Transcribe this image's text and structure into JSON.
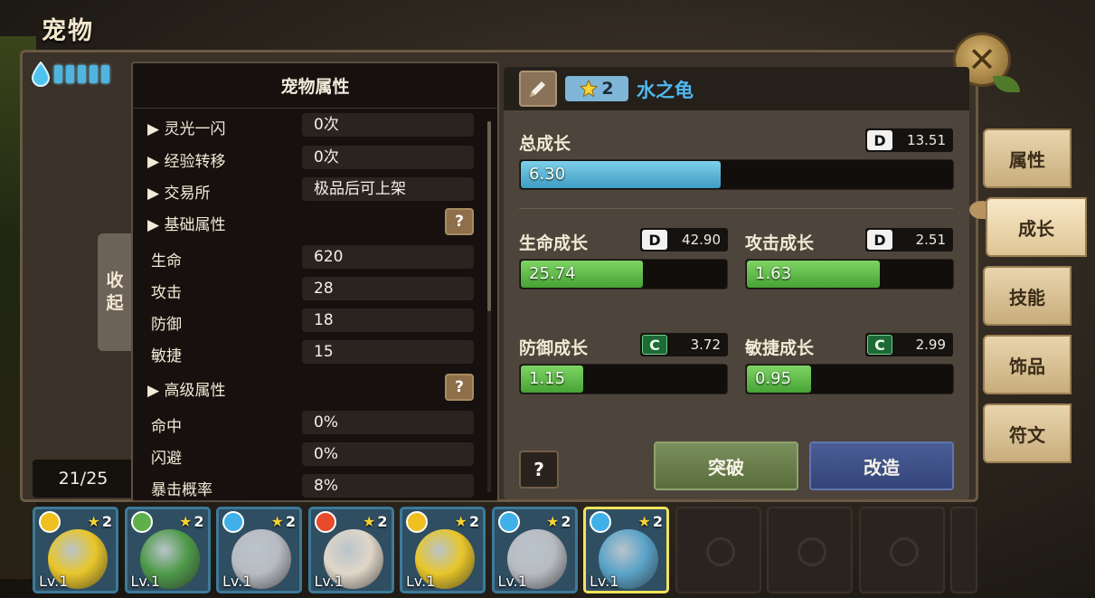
{
  "page_title": "宠物",
  "collapse_label": [
    "收",
    "起"
  ],
  "pet_count": "21/25",
  "gauge": {
    "segments": 5,
    "color": "#4fb4e0"
  },
  "attr_panel": {
    "title": "宠物属性",
    "rows": [
      {
        "label": "▶ 灵光一闪",
        "value": "0次"
      },
      {
        "label": "▶ 经验转移",
        "value": "0次"
      },
      {
        "label": "▶ 交易所",
        "value": "极品后可上架"
      },
      {
        "label": "▶ 基础属性",
        "value": null,
        "help": "?"
      },
      {
        "label": "生命",
        "value": "620"
      },
      {
        "label": "攻击",
        "value": "28"
      },
      {
        "label": "防御",
        "value": "18"
      },
      {
        "label": "敏捷",
        "value": "15"
      },
      {
        "label": "▶ 高级属性",
        "value": null,
        "help": "?"
      },
      {
        "label": "命中",
        "value": "0%"
      },
      {
        "label": "闪避",
        "value": "0%"
      },
      {
        "label": "暴击概率",
        "value": "8%"
      }
    ]
  },
  "growth": {
    "star_level": "2",
    "pet_name": "水之龟",
    "total": {
      "label": "总成长",
      "grade": "D",
      "max": "13.51",
      "value": "6.30",
      "fraction": 0.466
    },
    "hp": {
      "label": "生命成长",
      "grade": "D",
      "max": "42.90",
      "value": "25.74",
      "fraction": 0.6
    },
    "atk": {
      "label": "攻击成长",
      "grade": "D",
      "max": "2.51",
      "value": "1.63",
      "fraction": 0.65
    },
    "def": {
      "label": "防御成长",
      "grade": "C",
      "max": "3.72",
      "value": "1.15",
      "fraction": 0.31
    },
    "agi": {
      "label": "敏捷成长",
      "grade": "C",
      "max": "2.99",
      "value": "0.95",
      "fraction": 0.32
    },
    "help": "?",
    "break_label": "突破",
    "reform_label": "改造"
  },
  "tabs": [
    "属性",
    "成长",
    "技能",
    "饰品",
    "符文"
  ],
  "active_tab": "成长",
  "pets": [
    {
      "element": "lightning",
      "stars": "2",
      "level": "Lv.1",
      "color": "#e8c62a"
    },
    {
      "element": "nature",
      "stars": "2",
      "level": "Lv.1",
      "color": "#4f9a4a"
    },
    {
      "element": "water",
      "stars": "2",
      "level": "Lv.1",
      "color": "#b8bcc2"
    },
    {
      "element": "fire",
      "stars": "2",
      "level": "Lv.1",
      "color": "#e0d6c8"
    },
    {
      "element": "lightning",
      "stars": "2",
      "level": "Lv.1",
      "color": "#e8c62a"
    },
    {
      "element": "water",
      "stars": "2",
      "level": "Lv.1",
      "color": "#b8bcc2"
    },
    {
      "element": "water",
      "stars": "2",
      "level": "Lv.1",
      "color": "#5aa3c8"
    }
  ]
}
